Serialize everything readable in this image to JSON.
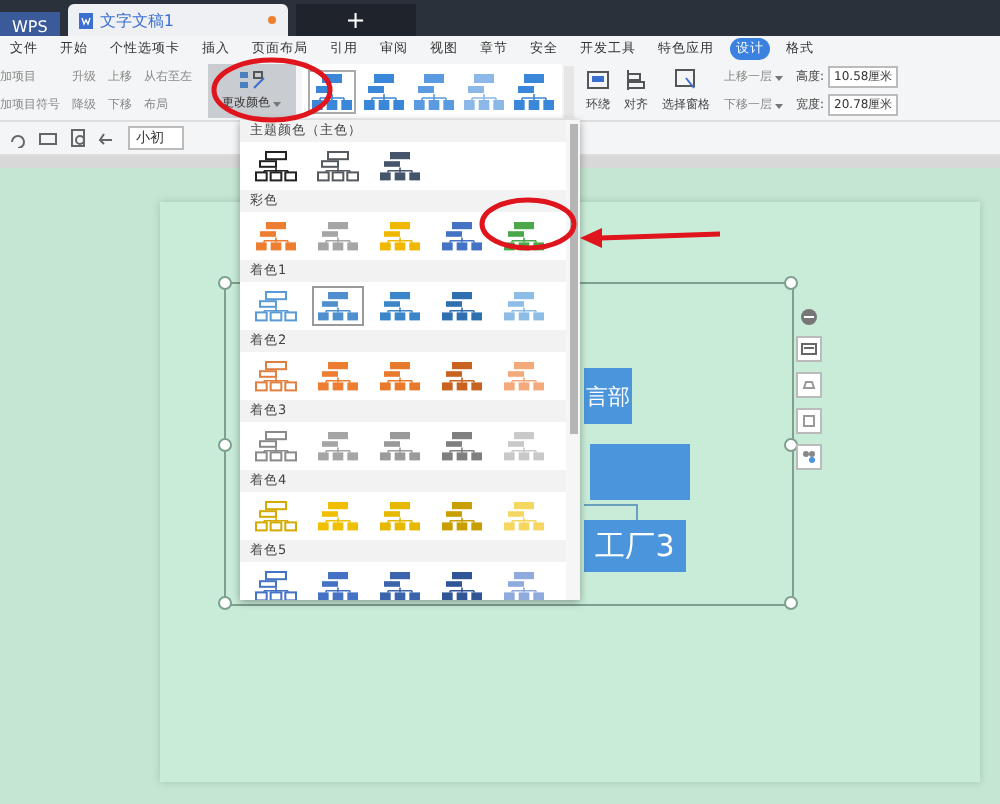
{
  "title_bar": {
    "app_tab": "WPS",
    "document_tab": "文字文稿1",
    "add_tab": "+"
  },
  "menu": [
    {
      "label": "文件",
      "selected": false
    },
    {
      "label": "开始",
      "selected": false
    },
    {
      "label": "个性选项卡",
      "selected": false
    },
    {
      "label": "插入",
      "selected": false
    },
    {
      "label": "页面布局",
      "selected": false
    },
    {
      "label": "引用",
      "selected": false
    },
    {
      "label": "审阅",
      "selected": false
    },
    {
      "label": "视图",
      "selected": false
    },
    {
      "label": "章节",
      "selected": false
    },
    {
      "label": "安全",
      "selected": false
    },
    {
      "label": "开发工具",
      "selected": false
    },
    {
      "label": "特色应用",
      "selected": false
    },
    {
      "label": "设计",
      "selected": true
    },
    {
      "label": "格式",
      "selected": false
    }
  ],
  "ribbon": {
    "left_commands": [
      [
        "加项目",
        "加项目符号"
      ],
      [
        "升级",
        "降级"
      ],
      [
        "上移",
        "下移"
      ],
      [
        "从右至左",
        "布局"
      ]
    ],
    "change_color": "更改颜色",
    "right_commands": [
      "环绕",
      "对齐",
      "选择窗格"
    ],
    "layer_commands": [
      "上移一层",
      "下移一层"
    ],
    "height_label": "高度:",
    "height_value": "10.58厘米",
    "width_label": "宽度:",
    "width_value": "20.78厘米"
  },
  "font_size": "小初",
  "color_menu": {
    "sections": [
      {
        "label": "主题颜色（主色）",
        "items": [
          {
            "kind": "outline",
            "color": "#222222",
            "selected": false
          },
          {
            "kind": "outline",
            "color": "#555a60",
            "selected": false
          },
          {
            "kind": "filled",
            "color": "#44546a",
            "selected": false
          }
        ]
      },
      {
        "label": "彩色",
        "items": [
          {
            "kind": "filled",
            "color": "#ed7d31",
            "selected": false
          },
          {
            "kind": "filled",
            "color": "#a5a5a5",
            "selected": false
          },
          {
            "kind": "filled",
            "color": "#f0b800",
            "selected": false
          },
          {
            "kind": "filled",
            "color": "#4472c4",
            "selected": false
          },
          {
            "kind": "filled",
            "color": "#4aa84a",
            "selected": false
          }
        ]
      },
      {
        "label": "着色1",
        "items": [
          {
            "kind": "outline",
            "color": "#5b9bd5",
            "selected": false
          },
          {
            "kind": "filled",
            "color": "#4f8fcf",
            "selected": true
          },
          {
            "kind": "filled",
            "color": "#3a86c8",
            "selected": false
          },
          {
            "kind": "filled",
            "color": "#2e6fb0",
            "selected": false
          },
          {
            "kind": "filled",
            "color": "#8dbde6",
            "selected": false
          }
        ]
      },
      {
        "label": "着色2",
        "items": [
          {
            "kind": "outline",
            "color": "#e08040",
            "selected": false
          },
          {
            "kind": "filled",
            "color": "#ed7d31",
            "selected": false
          },
          {
            "kind": "filled",
            "color": "#e87a2c",
            "selected": false
          },
          {
            "kind": "filled",
            "color": "#c8621e",
            "selected": false
          },
          {
            "kind": "filled",
            "color": "#f4a97a",
            "selected": false
          }
        ]
      },
      {
        "label": "着色3",
        "items": [
          {
            "kind": "outline",
            "color": "#8a8a8a",
            "selected": false
          },
          {
            "kind": "filled",
            "color": "#a5a5a5",
            "selected": false
          },
          {
            "kind": "filled",
            "color": "#9a9a9a",
            "selected": false
          },
          {
            "kind": "filled",
            "color": "#7f7f7f",
            "selected": false
          },
          {
            "kind": "filled",
            "color": "#c9c9c9",
            "selected": false
          }
        ]
      },
      {
        "label": "着色4",
        "items": [
          {
            "kind": "outline",
            "color": "#d4a900",
            "selected": false
          },
          {
            "kind": "filled",
            "color": "#f0c000",
            "selected": false
          },
          {
            "kind": "filled",
            "color": "#e6b800",
            "selected": false
          },
          {
            "kind": "filled",
            "color": "#c89e00",
            "selected": false
          },
          {
            "kind": "filled",
            "color": "#f5d660",
            "selected": false
          }
        ]
      },
      {
        "label": "着色5",
        "items": [
          {
            "kind": "outline",
            "color": "#4472c4",
            "selected": false
          },
          {
            "kind": "filled",
            "color": "#4472c4",
            "selected": false
          },
          {
            "kind": "filled",
            "color": "#3b64ad",
            "selected": false
          },
          {
            "kind": "filled",
            "color": "#2f5597",
            "selected": false
          },
          {
            "kind": "filled",
            "color": "#8faadc",
            "selected": false
          }
        ]
      }
    ]
  },
  "diagram": {
    "nodes": [
      {
        "kind": "label",
        "text": "言部"
      },
      {
        "kind": "box"
      },
      {
        "kind": "label",
        "text": "工厂3"
      }
    ]
  }
}
